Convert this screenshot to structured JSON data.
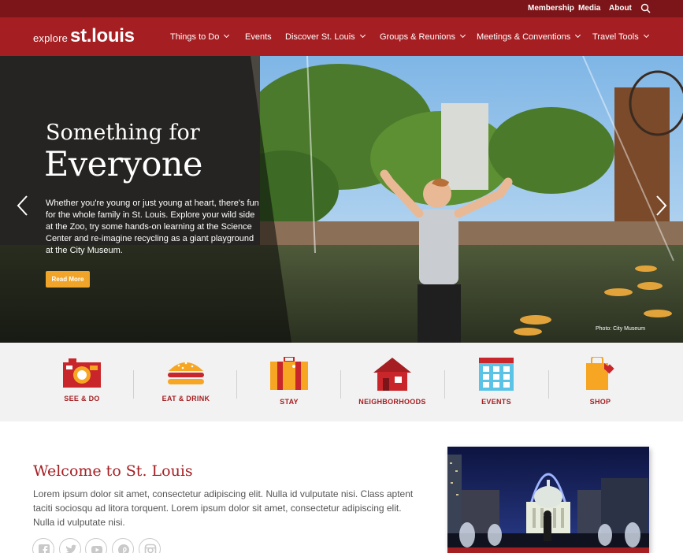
{
  "utility_nav": {
    "items": [
      {
        "label": "Membership"
      },
      {
        "label": "Media"
      },
      {
        "label": "About"
      }
    ],
    "search_icon": "search-icon"
  },
  "header": {
    "logo_small": "explore",
    "logo_big": "st.louis",
    "nav": [
      {
        "label": "Things to Do",
        "has_dropdown": true
      },
      {
        "label": "Events",
        "has_dropdown": false
      },
      {
        "label": "Discover St. Louis",
        "has_dropdown": true
      },
      {
        "label": "Groups & Reunions",
        "has_dropdown": true
      },
      {
        "label": "Meetings & Conventions",
        "has_dropdown": true
      },
      {
        "label": "Travel Tools",
        "has_dropdown": true
      }
    ]
  },
  "hero": {
    "title_line1": "Something for",
    "title_line2": "Everyone",
    "description": "Whether you're young or just young at heart, there's fun for the whole family in St. Louis. Explore your wild side at the Zoo, try some hands-on learning at the Science Center and re-imagine recycling as a giant playground at the City Museum.",
    "button_label": "Read More",
    "photo_credit": "Photo: City Museum",
    "prev_icon": "chevron-left-icon",
    "next_icon": "chevron-right-icon"
  },
  "categories": [
    {
      "label": "SEE & DO",
      "icon": "camera-icon"
    },
    {
      "label": "EAT & DRINK",
      "icon": "burger-icon"
    },
    {
      "label": "STAY",
      "icon": "suitcase-icon"
    },
    {
      "label": "NEIGHBORHOODS",
      "icon": "house-icon"
    },
    {
      "label": "EVENTS",
      "icon": "calendar-icon"
    },
    {
      "label": "SHOP",
      "icon": "shopping-bag-icon"
    }
  ],
  "welcome": {
    "title": "Welcome to St. Louis",
    "body": "Lorem ipsum dolor sit amet, consectetur adipiscing elit. Nulla id vulputate nisi. Class aptent taciti sociosqu ad litora torquent. Lorem ipsum dolor sit amet, consectetur adipiscing elit. Nulla id vulputate nisi."
  },
  "social": [
    "facebook-icon",
    "twitter-icon",
    "youtube-icon",
    "pinterest-icon",
    "instagram-icon"
  ],
  "colors": {
    "brand_red": "#a51e22",
    "utility_red": "#7c1519",
    "accent_orange": "#f0a52a",
    "strip_gray": "#f2f2f2"
  }
}
